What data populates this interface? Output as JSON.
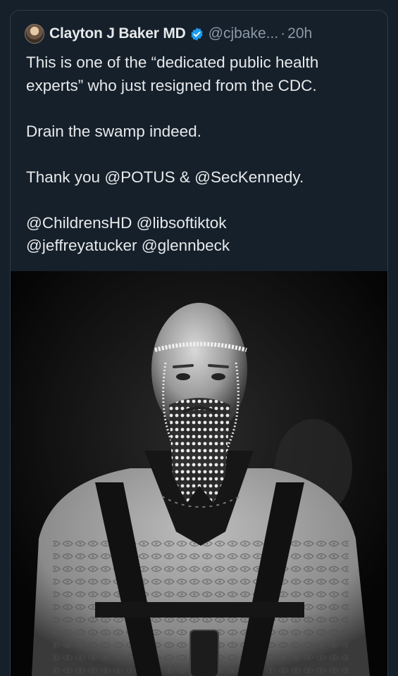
{
  "tweet": {
    "author": {
      "display_name": "Clayton J Baker MD",
      "verified": true,
      "handle": "@cjbake...",
      "separator": "·",
      "timestamp": "20h",
      "avatar_icon": "profile-avatar"
    },
    "text_lines": [
      "This is one of the “dedicated public health",
      "experts” who just resigned from the CDC.",
      "",
      "Drain the swamp indeed.",
      "",
      "Thank you @POTUS & @SecKennedy.",
      "",
      "@ChildrensHD @libsoftiktok",
      "@jeffreyatucker @glennbeck"
    ],
    "media": {
      "type": "photo",
      "style": "black-and-white"
    }
  },
  "colors": {
    "background": "#15202b",
    "text": "#e7e9ea",
    "muted": "#8b98a5",
    "verified": "#1d9bf0",
    "border": "#2f3b47"
  }
}
